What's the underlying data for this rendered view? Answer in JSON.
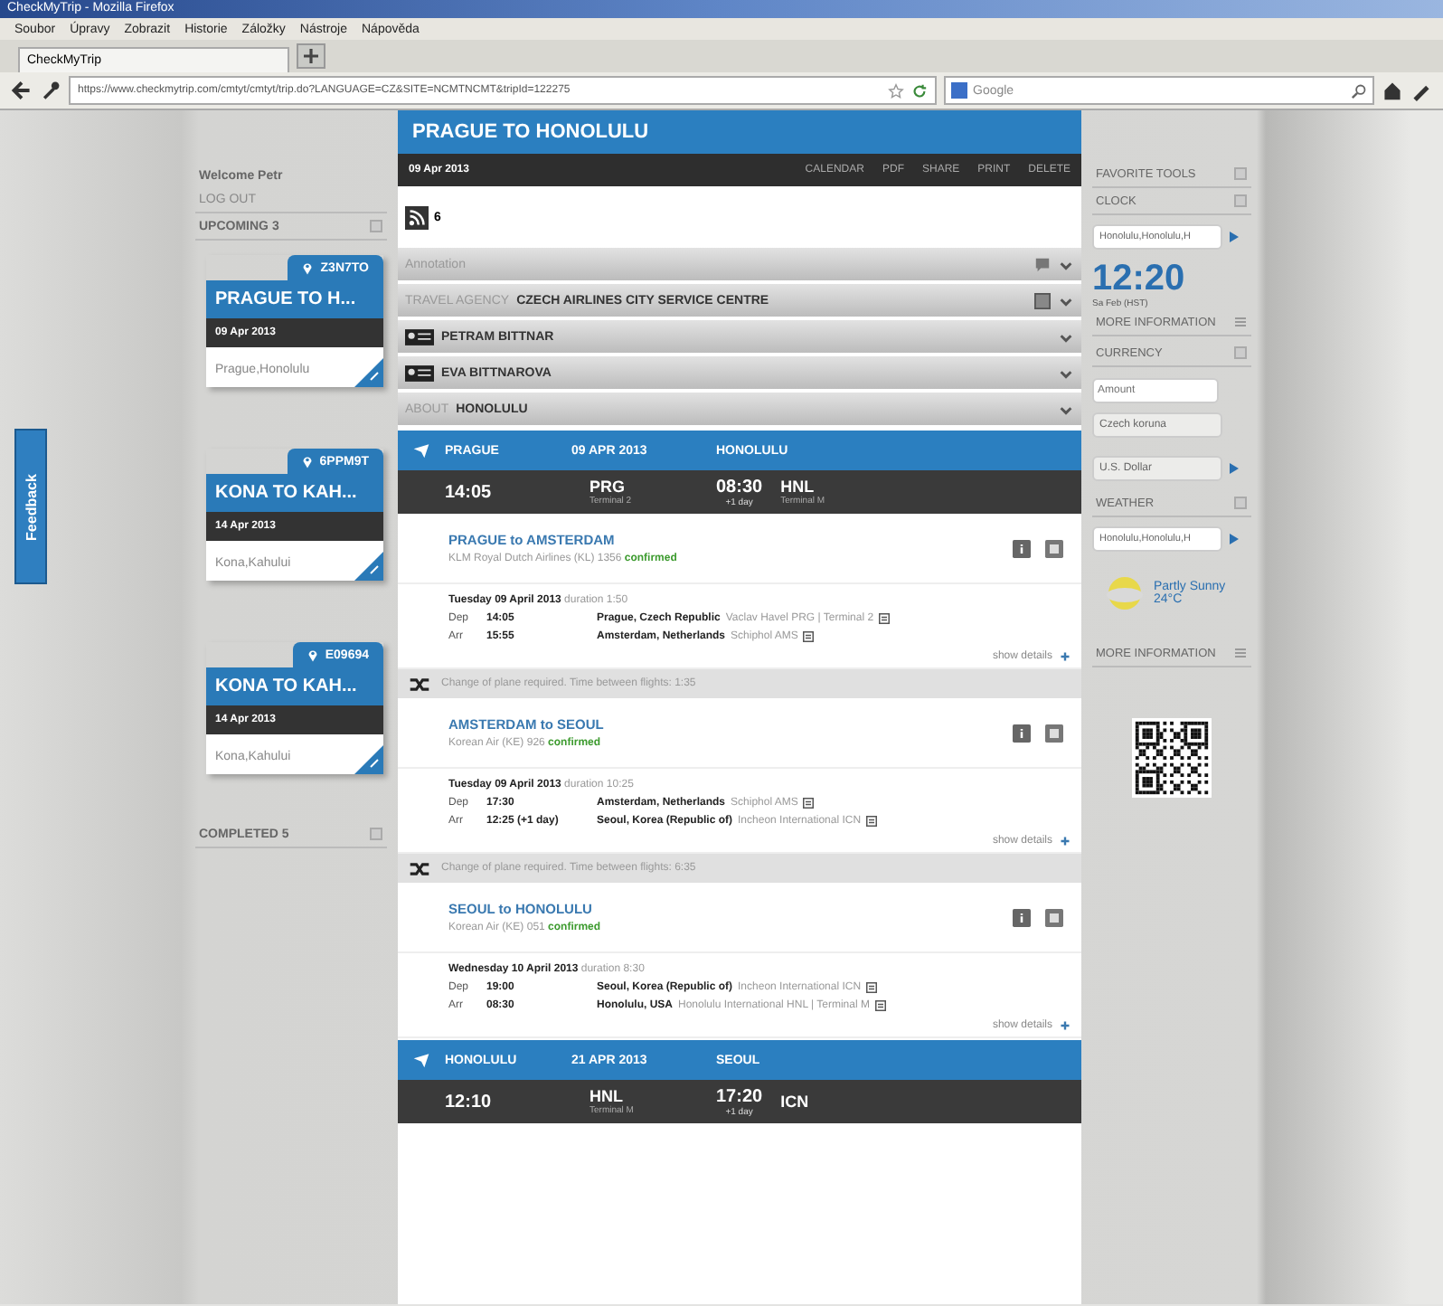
{
  "browser": {
    "title": "CheckMyTrip - Mozilla Firefox",
    "menu": [
      "Soubor",
      "Úpravy",
      "Zobrazit",
      "Historie",
      "Záložky",
      "Nástroje",
      "Nápověda"
    ],
    "tab": "CheckMyTrip",
    "url": "https://www.checkmytrip.com/cmtyt/cmtyt/trip.do?LANGUAGE=CZ&SITE=NCMTNCMT&tripId=122275",
    "search_placeholder": "Google"
  },
  "feedback": "Feedback",
  "sidebar": {
    "welcome": "Welcome Petr",
    "logout": "LOG OUT",
    "upcoming": "UPCOMING 3",
    "completed": "COMPLETED 5",
    "trips": [
      {
        "code": "Z3N7TO",
        "title": "PRAGUE TO H...",
        "date": "09 Apr 2013",
        "cities": "Prague,Honolulu"
      },
      {
        "code": "6PPM9T",
        "title": "KONA TO KAH...",
        "date": "14 Apr 2013",
        "cities": "Kona,Kahului"
      },
      {
        "code": "E09694",
        "title": "KONA TO KAH...",
        "date": "14 Apr 2013",
        "cities": "Kona,Kahului"
      }
    ]
  },
  "trip": {
    "title": "PRAGUE TO HONOLULU",
    "date": "09 Apr 2013",
    "actions": [
      "CALENDAR",
      "PDF",
      "SHARE",
      "PRINT",
      "DELETE"
    ],
    "rss_count": "6",
    "bars": [
      {
        "kind": "annotation",
        "label": "Annotation"
      },
      {
        "kind": "agency",
        "label": "TRAVEL AGENCY",
        "value": "CZECH AIRLINES CITY SERVICE CENTRE"
      },
      {
        "kind": "traveller",
        "value": "PETRAM BITTNAR"
      },
      {
        "kind": "traveller",
        "value": "EVA BITTNAROVA"
      },
      {
        "kind": "about",
        "label": "ABOUT",
        "value": "HONOLULU"
      }
    ],
    "items": [
      {
        "kind": "summary",
        "from": "PRAGUE",
        "date": "09 APR 2013",
        "to": "HONOLULU",
        "dep_time": "14:05",
        "dep_code": "PRG",
        "dep_terminal": "Terminal 2",
        "arr_time": "08:30",
        "arr_note": "+1 day",
        "arr_code": "HNL",
        "arr_terminal": "Terminal M"
      },
      {
        "kind": "segment",
        "title": "PRAGUE to AMSTERDAM",
        "carrier": "KLM Royal Dutch Airlines (KL) 1356",
        "status": "confirmed",
        "day": "Tuesday 09 April 2013",
        "duration": "duration 1:50",
        "details": "show details",
        "rows": [
          {
            "label": "Dep",
            "time": "14:05",
            "city": "Prague, Czech Republic",
            "airport": "Vaclav Havel PRG | Terminal 2"
          },
          {
            "label": "Arr",
            "time": "15:55",
            "city": "Amsterdam, Netherlands",
            "airport": "Schiphol AMS"
          }
        ]
      },
      {
        "kind": "change",
        "text": "Change of plane required. Time between flights: 1:35"
      },
      {
        "kind": "segment",
        "title": "AMSTERDAM to SEOUL",
        "carrier": "Korean Air (KE) 926",
        "status": "confirmed",
        "day": "Tuesday 09 April 2013",
        "duration": "duration 10:25",
        "details": "show details",
        "rows": [
          {
            "label": "Dep",
            "time": "17:30",
            "city": "Amsterdam, Netherlands",
            "airport": "Schiphol AMS"
          },
          {
            "label": "Arr",
            "time": "12:25 (+1 day)",
            "city": "Seoul, Korea (Republic of)",
            "airport": "Incheon International ICN"
          }
        ]
      },
      {
        "kind": "change",
        "text": "Change of plane required. Time between flights: 6:35"
      },
      {
        "kind": "segment",
        "title": "SEOUL to HONOLULU",
        "carrier": "Korean Air (KE) 051",
        "status": "confirmed",
        "day": "Wednesday 10 April 2013",
        "duration": "duration 8:30",
        "details": "show details",
        "rows": [
          {
            "label": "Dep",
            "time": "19:00",
            "city": "Seoul, Korea (Republic of)",
            "airport": "Incheon International ICN"
          },
          {
            "label": "Arr",
            "time": "08:30",
            "city": "Honolulu, USA",
            "airport": "Honolulu International HNL | Terminal M"
          }
        ]
      },
      {
        "kind": "summary",
        "from": "HONOLULU",
        "date": "21 APR 2013",
        "to": "SEOUL",
        "dep_time": "12:10",
        "dep_code": "HNL",
        "dep_terminal": "Terminal M",
        "arr_time": "17:20",
        "arr_note": "+1 day",
        "arr_code": "ICN"
      }
    ]
  },
  "tools": {
    "title": "FAVORITE TOOLS",
    "clock": {
      "title": "CLOCK",
      "city": "Honolulu,Honolulu,H",
      "time": "12:20",
      "zone": "Sa Feb (HST)",
      "more": "MORE INFORMATION"
    },
    "currency": {
      "title": "CURRENCY",
      "amount_placeholder": "Amount",
      "from": "Czech koruna",
      "to": "U.S. Dollar"
    },
    "weather": {
      "title": "WEATHER",
      "city": "Honolulu,Honolulu,H",
      "condition": "Partly Sunny",
      "temp": "24°C",
      "more": "MORE INFORMATION"
    }
  }
}
